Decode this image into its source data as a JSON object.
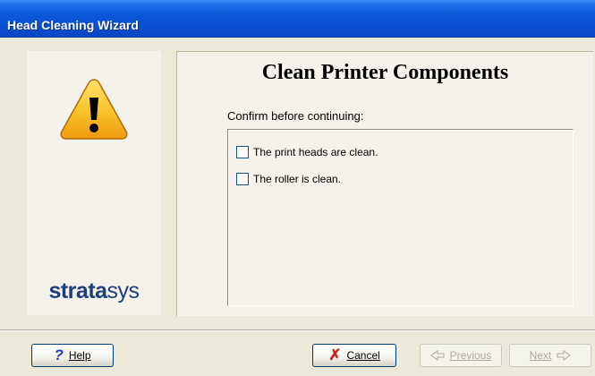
{
  "window": {
    "title": "Head Cleaning Wizard"
  },
  "brand": {
    "logo_bold": "strata",
    "logo_rest": "sys"
  },
  "content": {
    "heading": "Clean Printer Components",
    "confirm_text": "Confirm before continuing:",
    "checkboxes": [
      {
        "label": "The print heads are clean.",
        "checked": false
      },
      {
        "label": "The roller is clean.",
        "checked": false
      }
    ]
  },
  "buttons": {
    "help": {
      "label": "Help",
      "icon": "question-icon"
    },
    "cancel": {
      "label": "Cancel",
      "icon": "red-x-icon"
    },
    "previous": {
      "label": "Previous",
      "icon": "back-arrow-icon",
      "enabled": false
    },
    "next": {
      "label": "Next",
      "icon": "forward-arrow-icon",
      "enabled": false
    }
  },
  "colors": {
    "title_bar": "#0a4fd0",
    "accent_yellow": "#f5b51c",
    "brand": "#1d3f7a",
    "cancel_x": "#c8221a"
  }
}
